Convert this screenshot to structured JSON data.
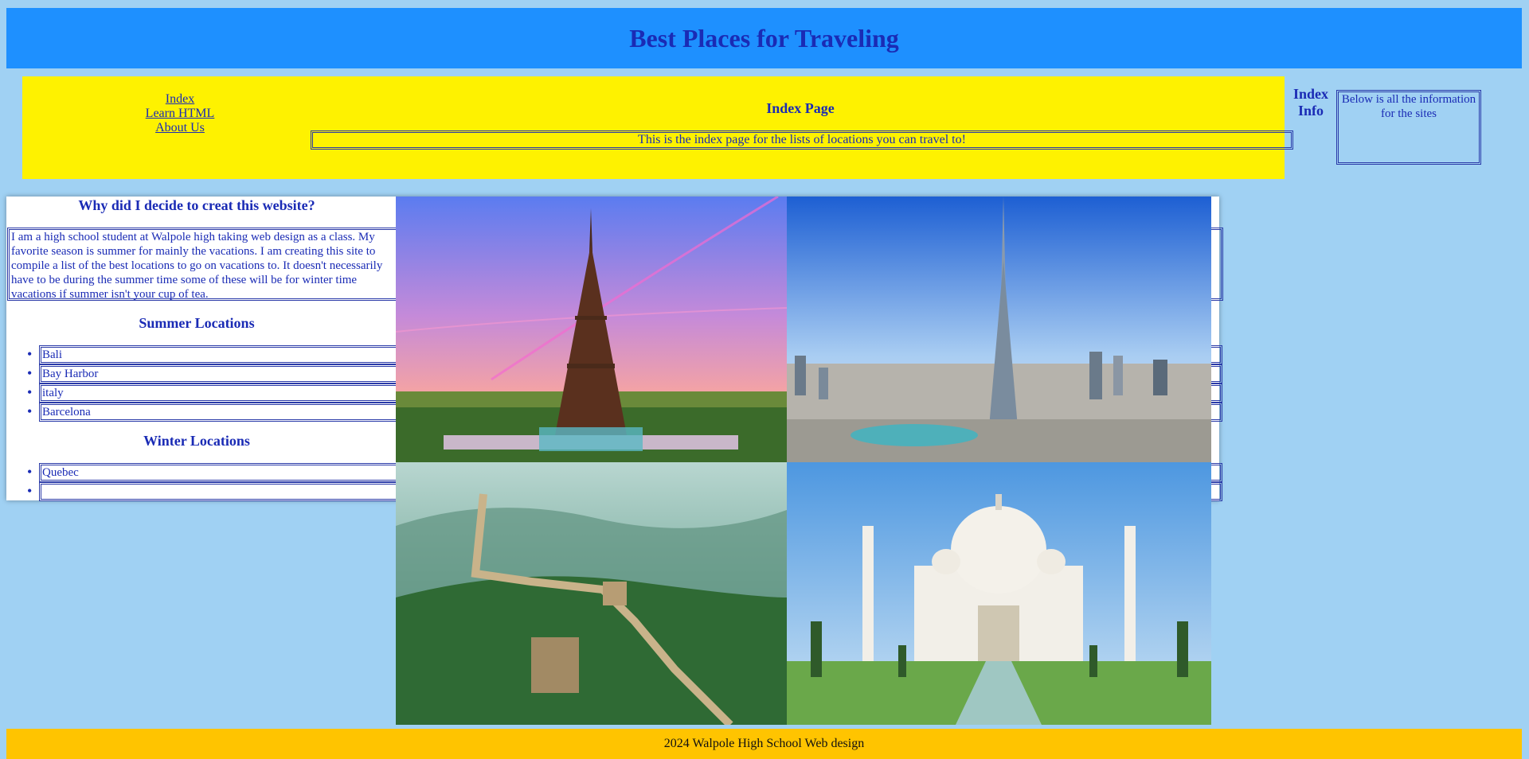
{
  "header": {
    "title": "Best Places for Traveling"
  },
  "nav": {
    "links": [
      "Index",
      "Learn HTML",
      "About Us"
    ],
    "page_title": "Index Page",
    "page_description": "This is the index page for the lists of locations you can travel to!"
  },
  "index_info": {
    "title": "Index Info",
    "text": "Below is all the information for the sites"
  },
  "about": {
    "heading": "Why did I decide to creat this website?",
    "text": "I am a high school student at Walpole high taking web design as a class. My favorite season is summer for mainly the vacations. I am creating this site to compile a list of the best locations to go on vacations to. It doesn't necessarily have to be during the summer time some of these will be for winter time vacations if summer isn't your cup of tea."
  },
  "summer": {
    "heading": "Summer Locations",
    "items": [
      "Bali",
      "Bay Harbor",
      "italy",
      "Barcelona"
    ]
  },
  "winter": {
    "heading": "Winter Locations",
    "items": [
      "Quebec",
      ""
    ]
  },
  "gallery": {
    "photos": [
      {
        "name": "eiffel-tower-photo"
      },
      {
        "name": "burj-khalifa-photo"
      },
      {
        "name": "great-wall-photo"
      },
      {
        "name": "taj-mahal-photo"
      }
    ]
  },
  "footer": {
    "text": "2024 Walpole High School Web design"
  }
}
